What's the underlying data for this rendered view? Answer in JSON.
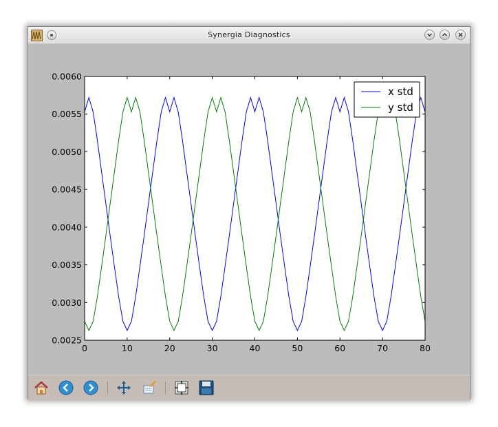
{
  "window": {
    "title": "Synergia Diagnostics",
    "app_icon": "waveform-icon",
    "buttons": [
      "minimize-icon",
      "maximize-icon",
      "close-icon"
    ]
  },
  "toolbar": {
    "items": [
      {
        "name": "home-button",
        "icon": "home-icon"
      },
      {
        "name": "back-button",
        "icon": "arrow-left-icon"
      },
      {
        "name": "forward-button",
        "icon": "arrow-right-icon"
      },
      {
        "name": "pan-button",
        "icon": "move-arrows-icon"
      },
      {
        "name": "zoom-button",
        "icon": "zoom-rectangle-icon"
      },
      {
        "name": "subplots-button",
        "icon": "subplots-config-icon"
      },
      {
        "name": "save-button",
        "icon": "floppy-disk-icon"
      }
    ]
  },
  "chart_data": {
    "type": "line",
    "title": "",
    "xlabel": "",
    "ylabel": "",
    "xlim": [
      0,
      80
    ],
    "ylim": [
      0.0025,
      0.006
    ],
    "xticks": [
      "0",
      "10",
      "20",
      "30",
      "40",
      "50",
      "60",
      "70",
      "80"
    ],
    "yticks": [
      "0.0025",
      "0.0030",
      "0.0035",
      "0.0040",
      "0.0045",
      "0.0050",
      "0.0055",
      "0.0060"
    ],
    "grid": false,
    "legend": "top-right",
    "colors": {
      "x std": "#0000ff",
      "y std": "#008000"
    },
    "series": [
      {
        "name": "x std",
        "x": [
          0,
          1,
          2,
          3,
          4,
          5,
          6,
          7,
          8,
          9,
          10,
          11,
          12,
          13,
          14,
          15,
          16,
          17,
          18,
          19,
          20,
          21,
          22,
          23,
          24,
          25,
          26,
          27,
          28,
          29,
          30,
          31,
          32,
          33,
          34,
          35,
          36,
          37,
          38,
          39,
          40,
          41,
          42,
          43,
          44,
          45,
          46,
          47,
          48,
          49,
          50,
          51,
          52,
          53,
          54,
          55,
          56,
          57,
          58,
          59,
          60,
          61,
          62,
          63,
          64,
          65,
          66,
          67,
          68,
          69,
          70,
          71,
          72,
          73,
          74,
          75,
          76,
          77,
          78,
          79,
          80
        ],
        "values": [
          0.00553,
          0.00572,
          0.00553,
          0.00515,
          0.00473,
          0.00431,
          0.00389,
          0.00348,
          0.00308,
          0.00275,
          0.00263,
          0.00275,
          0.00308,
          0.00348,
          0.00389,
          0.00431,
          0.00473,
          0.00515,
          0.00553,
          0.00572,
          0.00553,
          0.00572,
          0.00553,
          0.00515,
          0.00473,
          0.00431,
          0.00389,
          0.00348,
          0.00308,
          0.00275,
          0.00263,
          0.00275,
          0.00308,
          0.00348,
          0.00389,
          0.00431,
          0.00473,
          0.00515,
          0.00553,
          0.00572,
          0.00553,
          0.00572,
          0.00553,
          0.00515,
          0.00473,
          0.00431,
          0.00389,
          0.00348,
          0.00308,
          0.00275,
          0.00263,
          0.00275,
          0.00308,
          0.00348,
          0.00389,
          0.00431,
          0.00473,
          0.00515,
          0.00553,
          0.00572,
          0.00553,
          0.00572,
          0.00553,
          0.00515,
          0.00473,
          0.00431,
          0.00389,
          0.00348,
          0.00308,
          0.00275,
          0.00263,
          0.00275,
          0.00308,
          0.00348,
          0.00389,
          0.00431,
          0.00473,
          0.00515,
          0.00553,
          0.00572,
          0.00553
        ]
      },
      {
        "name": "y std",
        "x": [
          0,
          1,
          2,
          3,
          4,
          5,
          6,
          7,
          8,
          9,
          10,
          11,
          12,
          13,
          14,
          15,
          16,
          17,
          18,
          19,
          20,
          21,
          22,
          23,
          24,
          25,
          26,
          27,
          28,
          29,
          30,
          31,
          32,
          33,
          34,
          35,
          36,
          37,
          38,
          39,
          40,
          41,
          42,
          43,
          44,
          45,
          46,
          47,
          48,
          49,
          50,
          51,
          52,
          53,
          54,
          55,
          56,
          57,
          58,
          59,
          60,
          61,
          62,
          63,
          64,
          65,
          66,
          67,
          68,
          69,
          70,
          71,
          72,
          73,
          74,
          75,
          76,
          77,
          78,
          79,
          80
        ],
        "values": [
          0.00275,
          0.00263,
          0.00275,
          0.00308,
          0.00348,
          0.00389,
          0.00431,
          0.00473,
          0.00515,
          0.00553,
          0.00572,
          0.00553,
          0.00572,
          0.00553,
          0.00515,
          0.00473,
          0.00431,
          0.00389,
          0.00348,
          0.00308,
          0.00275,
          0.00263,
          0.00275,
          0.00308,
          0.00348,
          0.00389,
          0.00431,
          0.00473,
          0.00515,
          0.00553,
          0.00572,
          0.00553,
          0.00572,
          0.00553,
          0.00515,
          0.00473,
          0.00431,
          0.00389,
          0.00348,
          0.00308,
          0.00275,
          0.00263,
          0.00275,
          0.00308,
          0.00348,
          0.00389,
          0.00431,
          0.00473,
          0.00515,
          0.00553,
          0.00572,
          0.00553,
          0.00572,
          0.00553,
          0.00515,
          0.00473,
          0.00431,
          0.00389,
          0.00348,
          0.00308,
          0.00275,
          0.00263,
          0.00275,
          0.00308,
          0.00348,
          0.00389,
          0.00431,
          0.00473,
          0.00515,
          0.00553,
          0.00572,
          0.00553,
          0.00572,
          0.00553,
          0.00515,
          0.00473,
          0.00431,
          0.00389,
          0.00348,
          0.00308,
          0.00275
        ]
      }
    ]
  }
}
